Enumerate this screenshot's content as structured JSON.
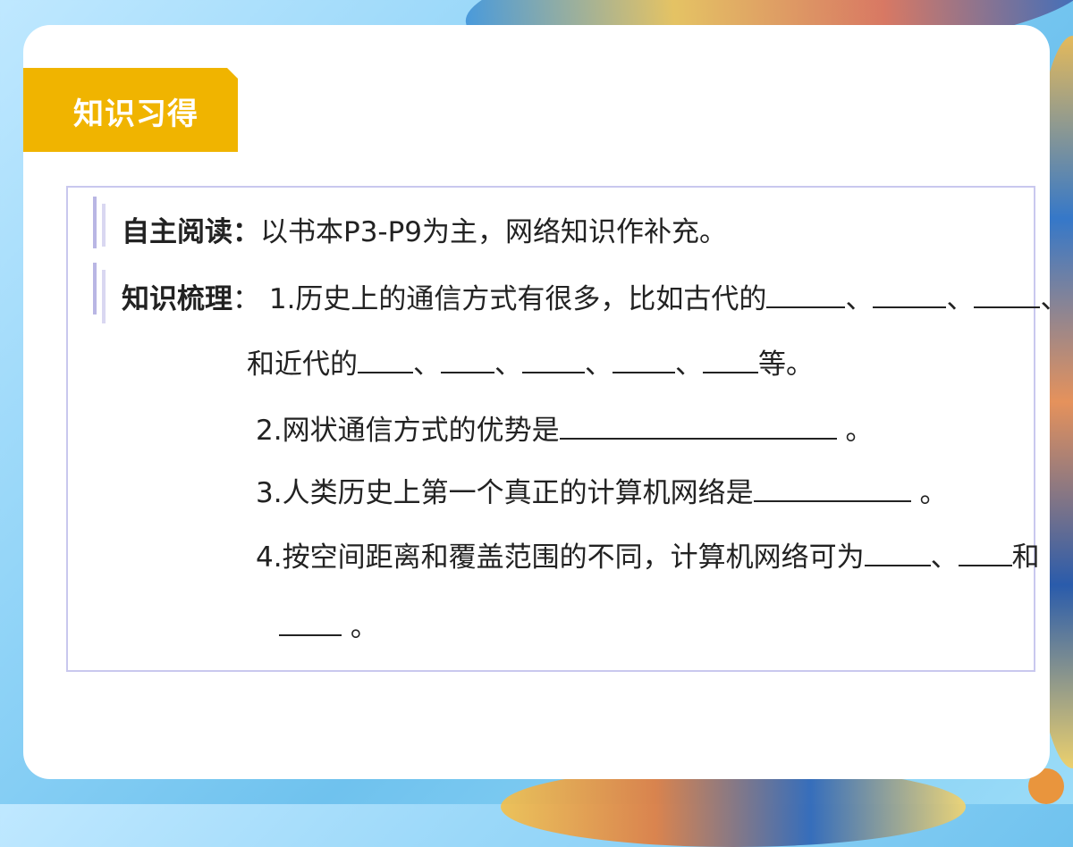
{
  "tag": {
    "label": "知识习得"
  },
  "reading": {
    "label": "自主阅读：",
    "text": "以书本P3-P9为主，网络知识作补充。"
  },
  "summary": {
    "label": "知识梳理",
    "colon": "：",
    "q1_a": "1.历史上的通信方式有很多，比如古代的",
    "sep": "、",
    "q1_b": "和近代的",
    "q1_end": "等。",
    "q2": "2.网状通信方式的优势是",
    "period": "。",
    "q3": "3.人类历史上第一个真正的计算机网络是",
    "q4": "4.按空间距离和覆盖范围的不同，计算机网络可为",
    "and": "和"
  }
}
